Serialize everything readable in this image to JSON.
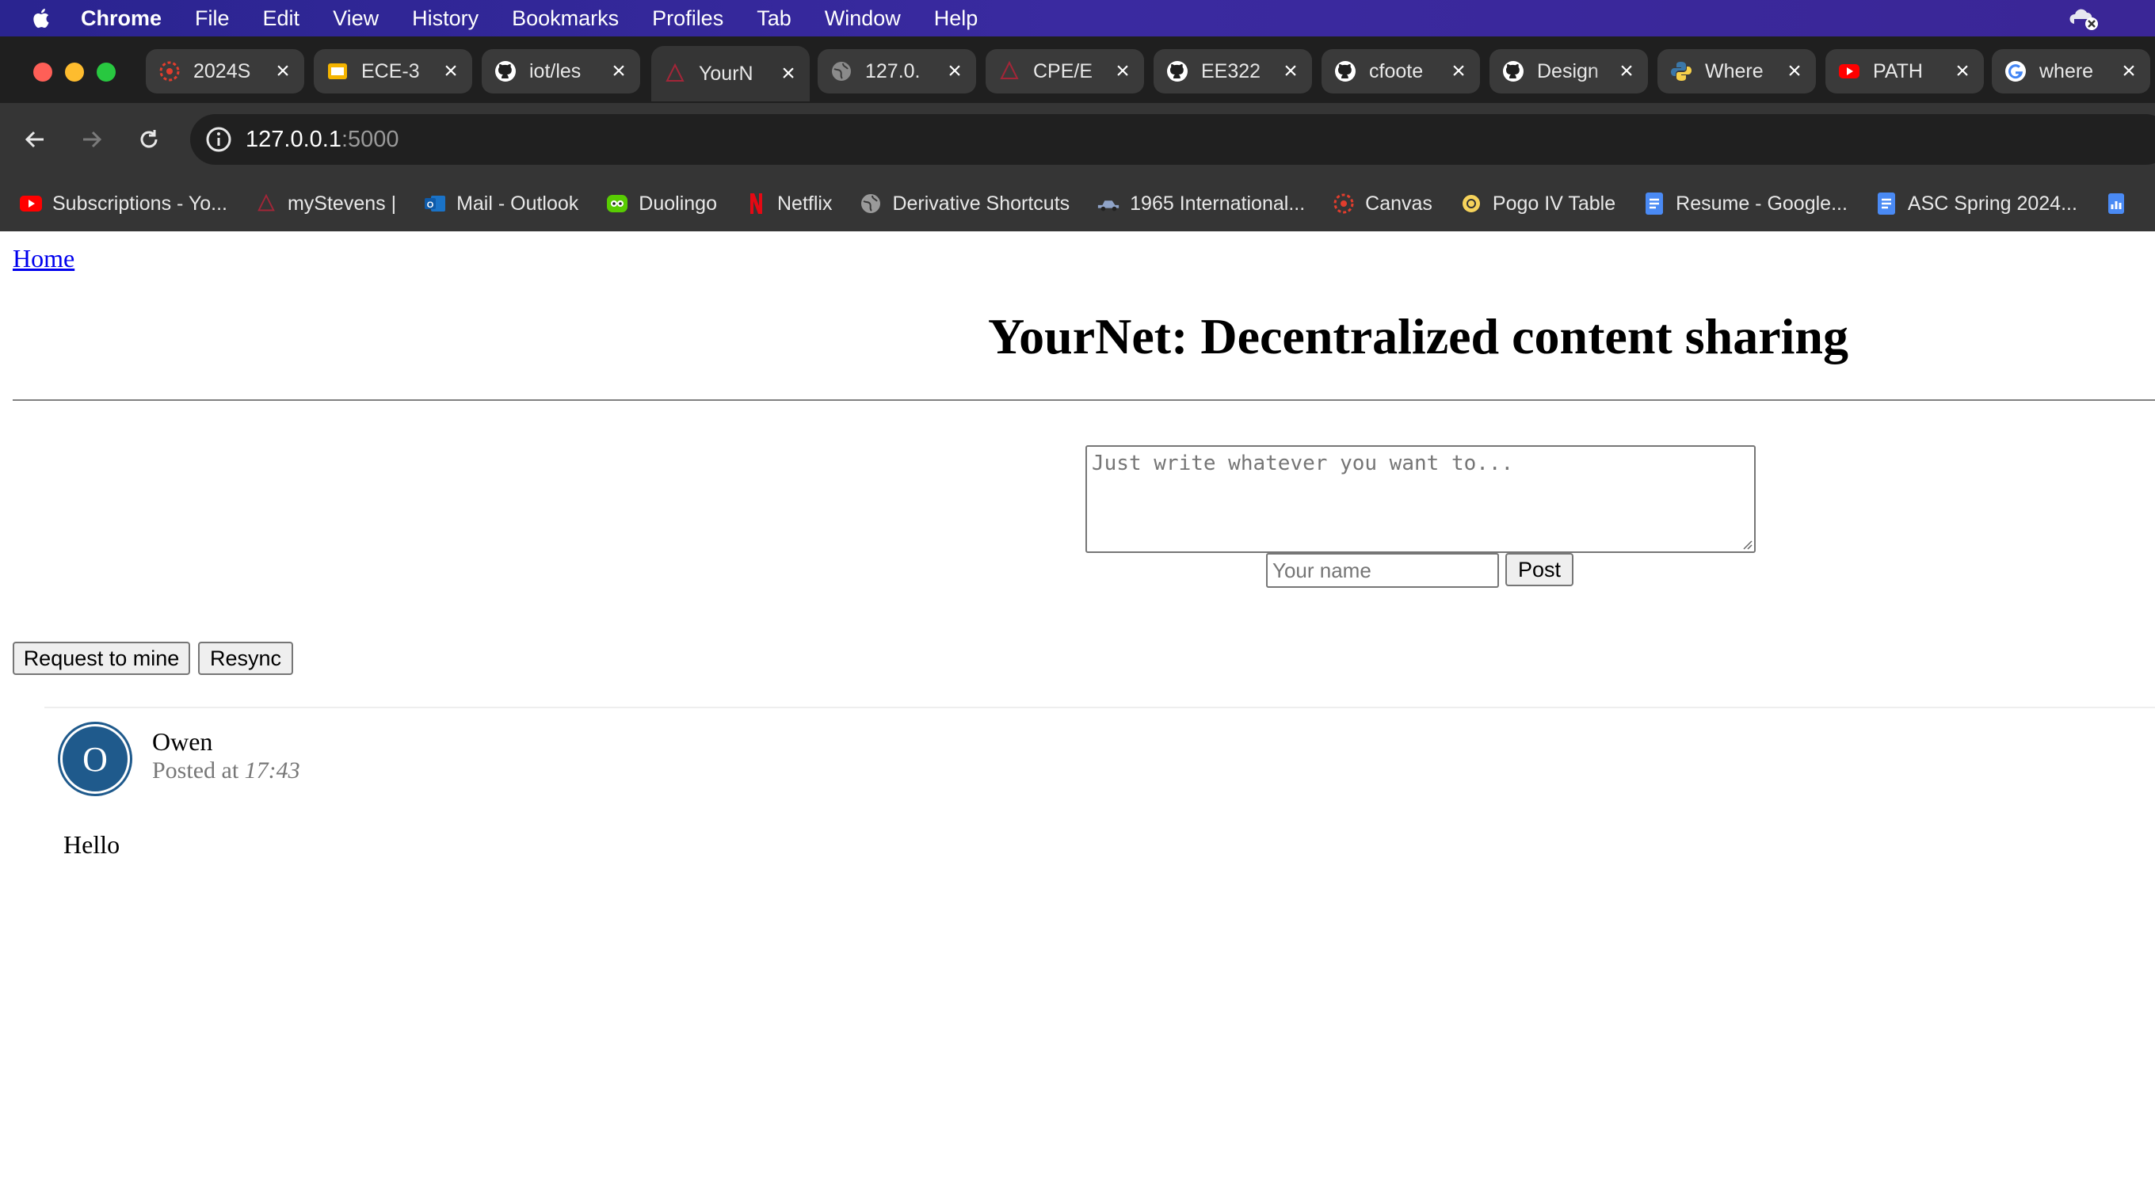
{
  "menubar": {
    "app": "Chrome",
    "items": [
      "File",
      "Edit",
      "View",
      "History",
      "Bookmarks",
      "Profiles",
      "Tab",
      "Window",
      "Help"
    ]
  },
  "tabs": [
    {
      "title": "2024S",
      "icon": "canvas-icon",
      "active": false
    },
    {
      "title": "ECE-3",
      "icon": "slides-icon",
      "active": false
    },
    {
      "title": "iot/les",
      "icon": "github-icon",
      "active": false
    },
    {
      "title": "YourN",
      "icon": "stevens-icon",
      "active": true
    },
    {
      "title": "127.0.",
      "icon": "globe-icon",
      "active": false
    },
    {
      "title": "CPE/E",
      "icon": "stevens-icon",
      "active": false
    },
    {
      "title": "EE322",
      "icon": "github-icon",
      "active": false
    },
    {
      "title": "cfoote",
      "icon": "github-icon",
      "active": false
    },
    {
      "title": "Design",
      "icon": "github-icon",
      "active": false
    },
    {
      "title": "Where",
      "icon": "python-icon",
      "active": false
    },
    {
      "title": "PATH",
      "icon": "youtube-icon",
      "active": false
    },
    {
      "title": "where",
      "icon": "google-icon",
      "active": false
    }
  ],
  "address": {
    "host": "127.0.0.1",
    "port": ":5000"
  },
  "bookmarks": [
    {
      "label": "Subscriptions - Yo...",
      "icon": "youtube-icon"
    },
    {
      "label": "myStevens |",
      "icon": "stevens-icon"
    },
    {
      "label": "Mail - Outlook",
      "icon": "outlook-icon"
    },
    {
      "label": "Duolingo",
      "icon": "duolingo-icon"
    },
    {
      "label": "Netflix",
      "icon": "netflix-icon"
    },
    {
      "label": "Derivative Shortcuts",
      "icon": "globe-icon"
    },
    {
      "label": "1965 International...",
      "icon": "truck-icon"
    },
    {
      "label": "Canvas",
      "icon": "canvas-icon"
    },
    {
      "label": "Pogo IV Table",
      "icon": "pogo-icon"
    },
    {
      "label": "Resume - Google...",
      "icon": "docs-icon"
    },
    {
      "label": "ASC Spring 2024...",
      "icon": "docs-icon"
    }
  ],
  "page": {
    "home_link": "Home",
    "title": "YourNet: Decentralized content sharing",
    "post_placeholder": "Just write whatever you want to...",
    "name_placeholder": "Your name",
    "post_button": "Post",
    "mine_button": "Request to mine",
    "resync_button": "Resync"
  },
  "post": {
    "avatar_letter": "O",
    "author": "Owen",
    "posted_prefix": "Posted at ",
    "time": "17:43",
    "body": "Hello"
  },
  "colors": {
    "menubar": "#2a2490",
    "tabstrip": "#1f1f1f",
    "toolbar": "#353535",
    "avatar": "#1f5a8c",
    "link": "#0000ee"
  }
}
